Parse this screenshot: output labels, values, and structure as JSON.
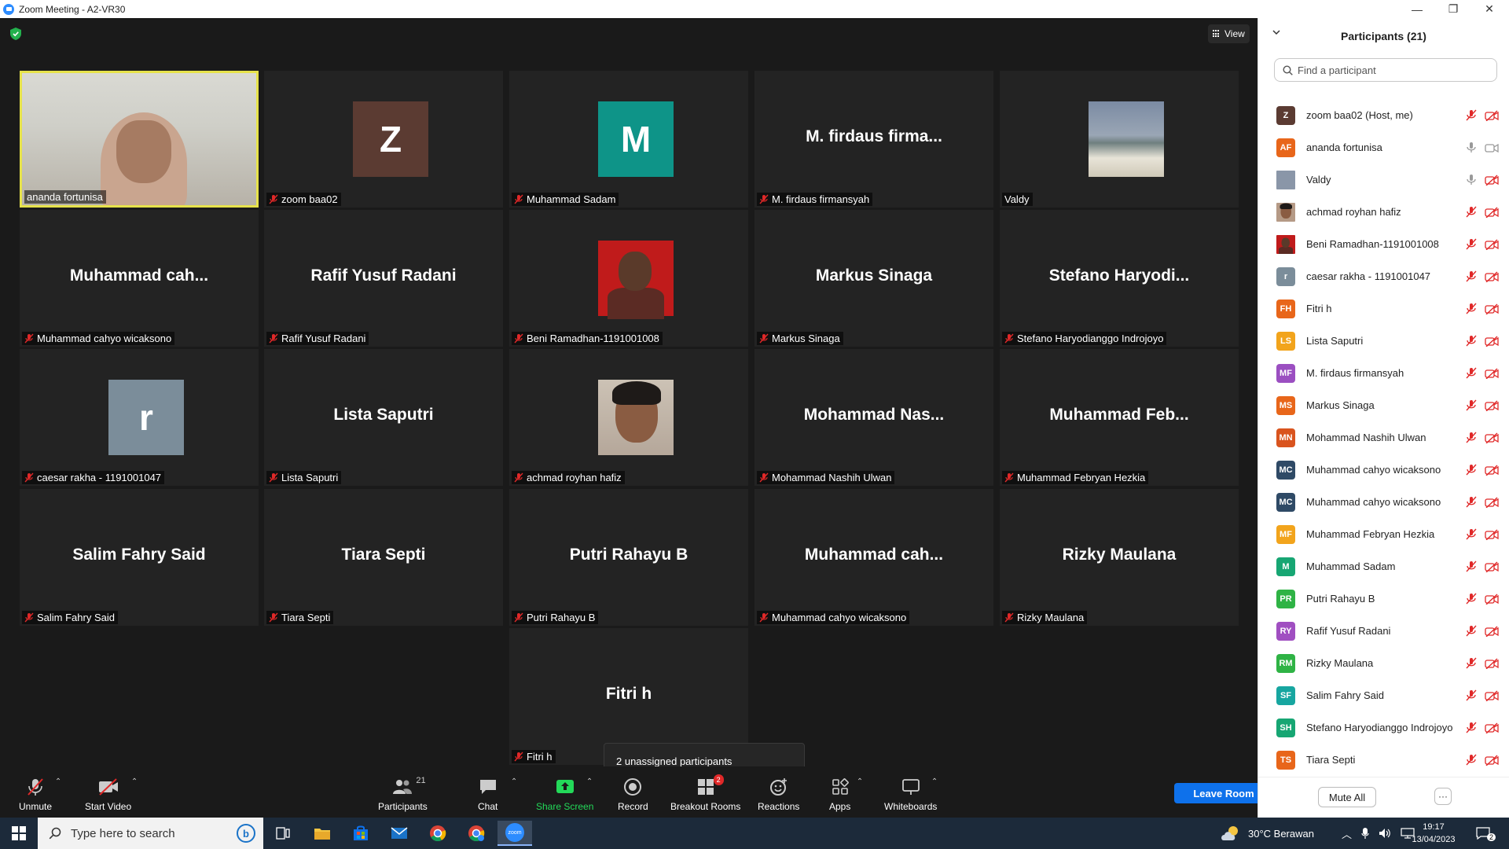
{
  "window": {
    "title": "Zoom Meeting - A2-VR30"
  },
  "view_button": {
    "label": "View"
  },
  "tiles": [
    {
      "big": "",
      "tag": "ananda fortunisa",
      "muted": false,
      "kind": "video"
    },
    {
      "big": "",
      "tag": "zoom baa02",
      "muted": true,
      "kind": "letter",
      "letter": "Z",
      "color": "#5b3b32"
    },
    {
      "big": "",
      "tag": "Muhammad Sadam",
      "muted": true,
      "kind": "letter",
      "letter": "M",
      "color": "#0e9488"
    },
    {
      "big": "M. firdaus firma...",
      "tag": "M. firdaus firmansyah",
      "muted": true,
      "kind": "name"
    },
    {
      "big": "",
      "tag": "Valdy",
      "muted": false,
      "kind": "photo",
      "photo": "car"
    },
    {
      "big": "Muhammad  cah...",
      "tag": "Muhammad cahyo wicaksono",
      "muted": true,
      "kind": "name"
    },
    {
      "big": "Rafif Yusuf Radani",
      "tag": "Rafif Yusuf Radani",
      "muted": true,
      "kind": "name"
    },
    {
      "big": "",
      "tag": "Beni Ramadhan-1191001008",
      "muted": true,
      "kind": "photo",
      "photo": "red"
    },
    {
      "big": "Markus Sinaga",
      "tag": "Markus Sinaga",
      "muted": true,
      "kind": "name"
    },
    {
      "big": "Stefano  Haryodi...",
      "tag": "Stefano Haryodianggo Indrojoyo",
      "muted": true,
      "kind": "name"
    },
    {
      "big": "",
      "tag": "caesar rakha - 1191001047",
      "muted": true,
      "kind": "letter",
      "letter": "r",
      "color": "#7b8d9a"
    },
    {
      "big": "Lista Saputri",
      "tag": "Lista Saputri",
      "muted": true,
      "kind": "name"
    },
    {
      "big": "",
      "tag": "achmad royhan hafiz",
      "muted": true,
      "kind": "photo",
      "photo": "selfie"
    },
    {
      "big": "Mohammad  Nas...",
      "tag": "Mohammad Nashih Ulwan",
      "muted": true,
      "kind": "name"
    },
    {
      "big": "Muhammad  Feb...",
      "tag": "Muhammad Febryan Hezkia",
      "muted": true,
      "kind": "name"
    },
    {
      "big": "Salim Fahry Said",
      "tag": "Salim Fahry Said",
      "muted": true,
      "kind": "name"
    },
    {
      "big": "Tiara Septi",
      "tag": "Tiara Septi",
      "muted": true,
      "kind": "name"
    },
    {
      "big": "Putri Rahayu B",
      "tag": "Putri Rahayu B",
      "muted": true,
      "kind": "name"
    },
    {
      "big": "Muhammad  cah...",
      "tag": "Muhammad cahyo wicaksono",
      "muted": true,
      "kind": "name"
    },
    {
      "big": "Rizky Maulana",
      "tag": "Rizky Maulana",
      "muted": true,
      "kind": "name"
    },
    {
      "big": "Fitri h",
      "tag": "Fitri h",
      "muted": true,
      "kind": "name"
    }
  ],
  "tooltip": {
    "text": "2 unassigned participants"
  },
  "toolbar": {
    "unmute": "Unmute",
    "start_video": "Start Video",
    "participants": "Participants",
    "participants_count": "21",
    "chat": "Chat",
    "share_screen": "Share Screen",
    "record": "Record",
    "breakout_rooms": "Breakout Rooms",
    "breakout_badge": "2",
    "reactions": "Reactions",
    "apps": "Apps",
    "whiteboards": "Whiteboards",
    "leave": "Leave Room"
  },
  "panel": {
    "title": "Participants (21)",
    "search_placeholder": "Find a participant",
    "mute_all": "Mute All",
    "more": "···",
    "participants": [
      {
        "initials": "Z",
        "name": "zoom baa02 (Host, me)",
        "color": "#5b3b32",
        "mic": "off",
        "video": "off"
      },
      {
        "initials": "AF",
        "name": "ananda fortunisa",
        "color": "#e8661a",
        "mic": "on",
        "video": "on"
      },
      {
        "initials": "",
        "name": "Valdy",
        "color": "#8a96a8",
        "mic": "on",
        "video": "off",
        "photo": "car"
      },
      {
        "initials": "",
        "name": "achmad royhan hafiz",
        "color": "#b59a86",
        "mic": "off",
        "video": "off",
        "photo": "selfie"
      },
      {
        "initials": "",
        "name": "Beni Ramadhan-1191001008",
        "color": "#c01b1b",
        "mic": "off",
        "video": "off",
        "photo": "red"
      },
      {
        "initials": "r",
        "name": "caesar rakha - 1191001047",
        "color": "#7b8d9a",
        "mic": "off",
        "video": "off"
      },
      {
        "initials": "FH",
        "name": "Fitri h",
        "color": "#e8661a",
        "mic": "off",
        "video": "off"
      },
      {
        "initials": "LS",
        "name": "Lista Saputri",
        "color": "#f2a41c",
        "mic": "off",
        "video": "off"
      },
      {
        "initials": "MF",
        "name": "M. firdaus firmansyah",
        "color": "#9b4fc1",
        "mic": "off",
        "video": "off"
      },
      {
        "initials": "MS",
        "name": "Markus Sinaga",
        "color": "#e8661a",
        "mic": "off",
        "video": "off"
      },
      {
        "initials": "MN",
        "name": "Mohammad Nashih Ulwan",
        "color": "#d9541e",
        "mic": "off",
        "video": "off"
      },
      {
        "initials": "MC",
        "name": "Muhammad cahyo wicaksono",
        "color": "#2f4a66",
        "mic": "off",
        "video": "off"
      },
      {
        "initials": "MC",
        "name": "Muhammad cahyo wicaksono",
        "color": "#2f4a66",
        "mic": "off",
        "video": "off"
      },
      {
        "initials": "MF",
        "name": "Muhammad Febryan Hezkia",
        "color": "#f2a41c",
        "mic": "off",
        "video": "off"
      },
      {
        "initials": "M",
        "name": "Muhammad Sadam",
        "color": "#17a673",
        "mic": "off",
        "video": "off"
      },
      {
        "initials": "PR",
        "name": "Putri Rahayu B",
        "color": "#2fb345",
        "mic": "off",
        "video": "off"
      },
      {
        "initials": "RY",
        "name": "Rafif Yusuf Radani",
        "color": "#a04fc1",
        "mic": "off",
        "video": "off"
      },
      {
        "initials": "RM",
        "name": "Rizky Maulana",
        "color": "#2fb345",
        "mic": "off",
        "video": "off"
      },
      {
        "initials": "SF",
        "name": "Salim Fahry Said",
        "color": "#17a6a0",
        "mic": "off",
        "video": "off"
      },
      {
        "initials": "SH",
        "name": "Stefano Haryodianggo Indrojoyo",
        "color": "#17a673",
        "mic": "off",
        "video": "off"
      },
      {
        "initials": "TS",
        "name": "Tiara Septi",
        "color": "#e8661a",
        "mic": "off",
        "video": "off"
      }
    ]
  },
  "taskbar": {
    "search_placeholder": "Type here to search",
    "weather": "30°C  Berawan",
    "time": "19:17",
    "date": "13/04/2023",
    "notif_count": "2"
  },
  "colors": {
    "accent": "#0e71eb",
    "share": "#23d959",
    "mute_red": "#e02828",
    "active_border": "#e6e24b"
  }
}
